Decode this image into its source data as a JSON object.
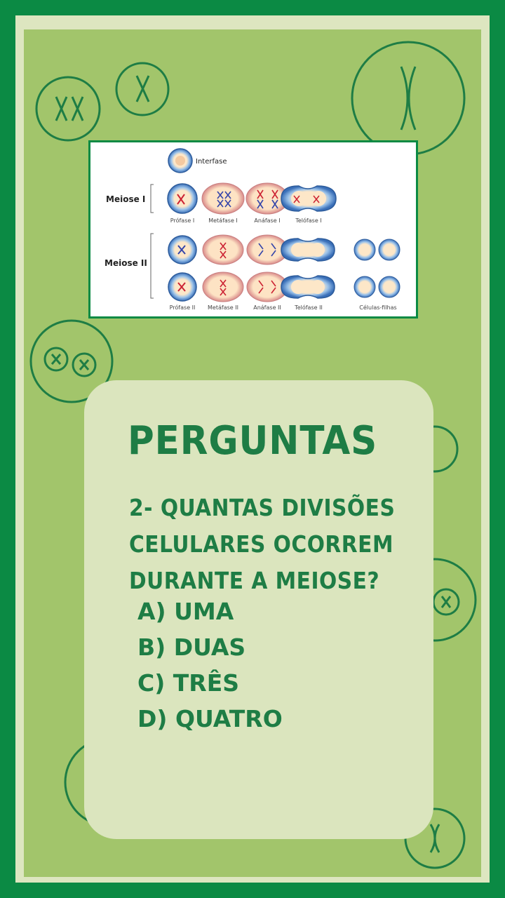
{
  "diagram": {
    "interfase_label": "Interfase",
    "meiose1_label": "Meiose I",
    "meiose2_label": "Meiose II",
    "stage_labels_1": [
      "Prófase I",
      "Metáfase I",
      "Anáfase I",
      "Telófase I"
    ],
    "stage_labels_2": [
      "Prófase II",
      "Metáfase II",
      "Anáfase II",
      "Telófase II",
      "Células-filhas"
    ]
  },
  "question": {
    "title": "PERGUNTAS",
    "lines": [
      "2- QUANTAS DIVISÕES",
      "CELULARES OCORREM",
      "DURANTE A MEIOSE?"
    ],
    "options": [
      "A) UMA",
      "B) DUAS",
      "C) TRÊS",
      "D) QUATRO"
    ]
  },
  "colors": {
    "frame": "#0b8a44",
    "inner_border": "#dde6c0",
    "background": "#a2c56b",
    "card": "#dbe5be",
    "text": "#1e7d45"
  }
}
